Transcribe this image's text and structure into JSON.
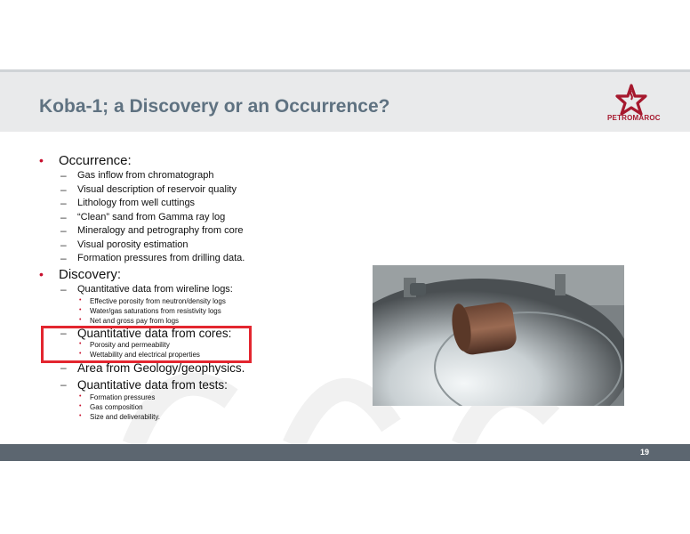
{
  "slide": {
    "title": "Koba-1; a Discovery or an Occurrence?",
    "logo_text": "PETROMAROC",
    "page_number": "19"
  },
  "content": {
    "occurrence": {
      "heading": "Occurrence:",
      "items": [
        "Gas inflow from chromatograph",
        "Visual description of reservoir quality",
        "Lithology from well cuttings",
        "“Clean” sand from Gamma ray log",
        "Mineralogy and petrography from core",
        "Visual porosity estimation",
        "Formation pressures from drilling data."
      ]
    },
    "discovery": {
      "heading": "Discovery:",
      "wireline": {
        "label": "Quantitative data from wireline logs:",
        "items": [
          "Effective porosity from neutron/density logs",
          "Water/gas saturations from resistivity logs",
          "Net and gross pay from logs"
        ]
      },
      "cores": {
        "label": "Quantitative data from cores:",
        "items": [
          "Porosity and permeability",
          "Wettability and electrical properties"
        ]
      },
      "area": {
        "label": "Area from Geology/geophysics."
      },
      "tests": {
        "label": "Quantitative data from tests:",
        "items": [
          "Formation pressures",
          "Gas composition",
          "Size and deliverability."
        ]
      }
    }
  },
  "colors": {
    "title": "#5f7281",
    "bullet": "#c8102e",
    "highlight": "#e3262f",
    "footer": "#5c6670"
  }
}
